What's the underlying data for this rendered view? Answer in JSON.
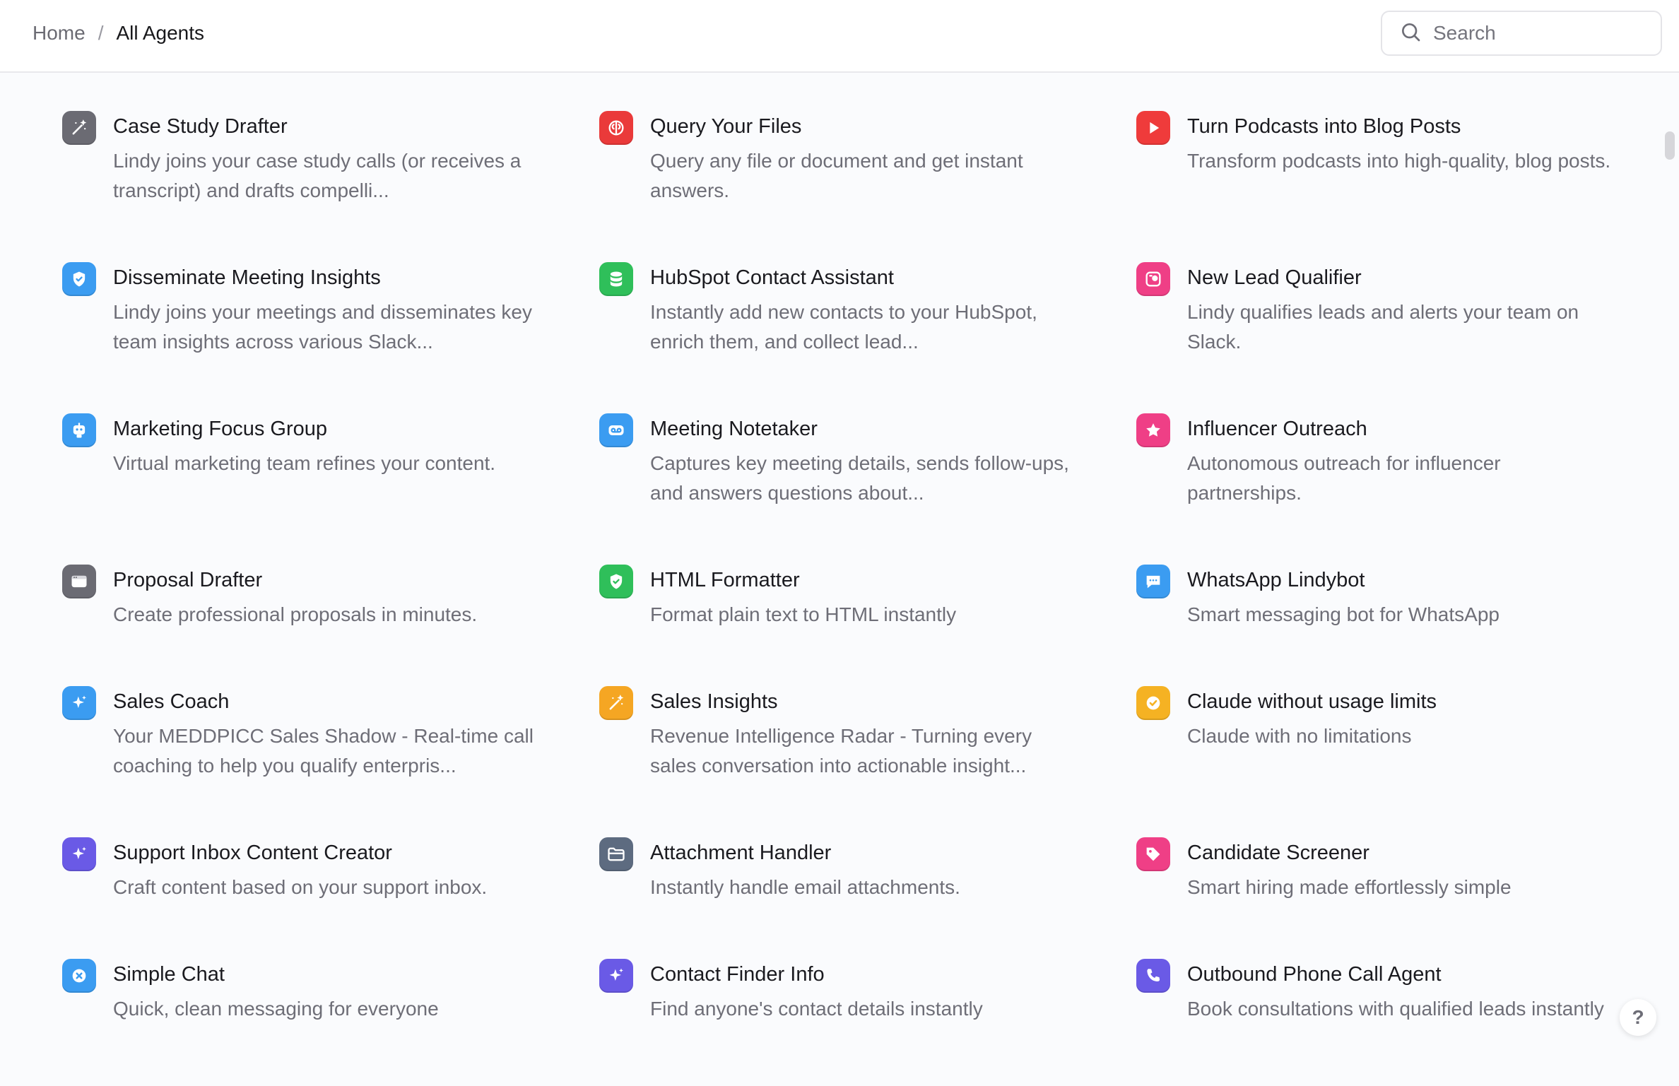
{
  "breadcrumb": {
    "home": "Home",
    "separator": "/",
    "current": "All Agents"
  },
  "search": {
    "placeholder": "Search",
    "value": ""
  },
  "help_label": "?",
  "agents": [
    {
      "title": "Case Study Drafter",
      "desc": "Lindy joins your case study calls (or receives a transcript) and drafts compelli...",
      "icon": "magic-wand-icon",
      "color": "#6b6b73"
    },
    {
      "title": "Query Your Files",
      "desc": "Query any file or document and get instant answers.",
      "icon": "brain-icon",
      "color": "#ea3a3a"
    },
    {
      "title": "Turn Podcasts into Blog Posts",
      "desc": "Transform podcasts into high-quality, blog posts.",
      "icon": "play-icon",
      "color": "#ef3b3b"
    },
    {
      "title": "Disseminate Meeting Insights",
      "desc": "Lindy joins your meetings and disseminates key team insights across various Slack...",
      "icon": "shield-check-icon",
      "color": "#3b9cf1"
    },
    {
      "title": "HubSpot Contact Assistant",
      "desc": "Instantly add new contacts to your HubSpot, enrich them, and collect lead...",
      "icon": "database-icon",
      "color": "#2fbf5a"
    },
    {
      "title": "New Lead Qualifier",
      "desc": "Lindy qualifies leads and alerts your team on Slack.",
      "icon": "id-card-icon",
      "color": "#ef3f86"
    },
    {
      "title": "Marketing Focus Group",
      "desc": "Virtual marketing team refines your content.",
      "icon": "robot-icon",
      "color": "#3b9cf1"
    },
    {
      "title": "Meeting Notetaker",
      "desc": "Captures key meeting details, sends follow-ups, and answers questions about...",
      "icon": "voicemail-icon",
      "color": "#3b9cf1"
    },
    {
      "title": "Influencer Outreach",
      "desc": "Autonomous outreach for influencer partnerships.",
      "icon": "star-icon",
      "color": "#ef3f86"
    },
    {
      "title": "Proposal Drafter",
      "desc": "Create professional proposals in minutes.",
      "icon": "browser-window-icon",
      "color": "#6b6b73"
    },
    {
      "title": "HTML Formatter",
      "desc": "Format plain text to HTML instantly",
      "icon": "shield-check-icon",
      "color": "#2fbf5a"
    },
    {
      "title": "WhatsApp Lindybot",
      "desc": "Smart messaging bot for WhatsApp",
      "icon": "chat-bubble-icon",
      "color": "#3b9cf1"
    },
    {
      "title": "Sales Coach",
      "desc": "Your MEDDPICC Sales Shadow - Real-time call coaching to help you qualify enterpris...",
      "icon": "sparkles-icon",
      "color": "#3b9cf1"
    },
    {
      "title": "Sales Insights",
      "desc": "Revenue Intelligence Radar - Turning every sales conversation into actionable insight...",
      "icon": "magic-wand-icon",
      "color": "#f5a623"
    },
    {
      "title": "Claude without usage limits",
      "desc": "Claude with no limitations",
      "icon": "check-circle-icon",
      "color": "#f5b223"
    },
    {
      "title": "Support Inbox Content Creator",
      "desc": "Craft content based on your support inbox.",
      "icon": "sparkles-icon",
      "color": "#6a5ae6"
    },
    {
      "title": "Attachment Handler",
      "desc": "Instantly handle email attachments.",
      "icon": "folder-icon",
      "color": "#5d6b80"
    },
    {
      "title": "Candidate Screener",
      "desc": "Smart hiring made effortlessly simple",
      "icon": "tag-icon",
      "color": "#ef3f86"
    },
    {
      "title": "Simple Chat",
      "desc": "Quick, clean messaging for everyone",
      "icon": "close-circle-icon",
      "color": "#3b9cf1"
    },
    {
      "title": "Contact Finder Info",
      "desc": "Find anyone's contact details instantly",
      "icon": "sparkles-icon",
      "color": "#6a5ae6"
    },
    {
      "title": "Outbound Phone Call Agent",
      "desc": "Book consultations with qualified leads instantly",
      "icon": "phone-icon",
      "color": "#6a5ae6"
    }
  ]
}
